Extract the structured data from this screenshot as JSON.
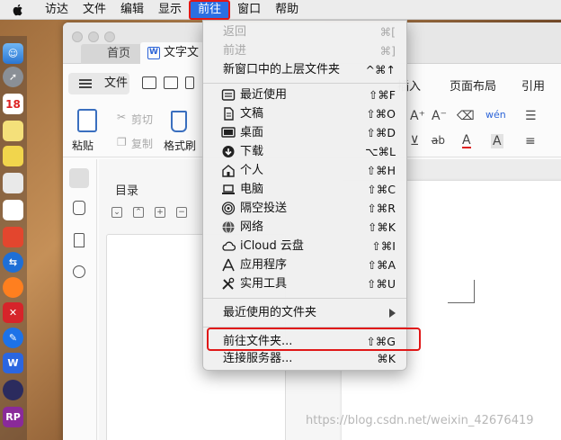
{
  "menubar": {
    "items": [
      "访达",
      "文件",
      "编辑",
      "显示",
      "前往",
      "窗口",
      "帮助"
    ],
    "active_index": 4
  },
  "window": {
    "tabs": [
      "首页",
      "文字文"
    ],
    "file_button": "文件",
    "ribbon_tabs": [
      "插入",
      "页面布局",
      "引用"
    ],
    "ribbon_labels": {
      "paste": "粘贴",
      "cut": "剪切",
      "copy": "复制",
      "format_painter": "格式刷"
    },
    "toc": {
      "title": "目录"
    }
  },
  "go_menu": {
    "items": [
      {
        "label": "返回",
        "shortcut": "⌘[",
        "disabled": true,
        "icon": ""
      },
      {
        "label": "前进",
        "shortcut": "⌘]",
        "disabled": true,
        "icon": ""
      },
      {
        "label": "新窗口中的上层文件夹",
        "shortcut": "^⌘↑",
        "disabled": false,
        "icon": ""
      },
      {
        "label": "最近使用",
        "shortcut": "⇧⌘F",
        "disabled": false,
        "icon": "recents-icon"
      },
      {
        "label": "文稿",
        "shortcut": "⇧⌘O",
        "disabled": false,
        "icon": "documents-icon"
      },
      {
        "label": "桌面",
        "shortcut": "⇧⌘D",
        "disabled": false,
        "icon": "desktop-icon"
      },
      {
        "label": "下载",
        "shortcut": "⌥⌘L",
        "disabled": false,
        "icon": "downloads-icon"
      },
      {
        "label": "个人",
        "shortcut": "⇧⌘H",
        "disabled": false,
        "icon": "home-icon"
      },
      {
        "label": "电脑",
        "shortcut": "⇧⌘C",
        "disabled": false,
        "icon": "computer-icon"
      },
      {
        "label": "隔空投送",
        "shortcut": "⇧⌘R",
        "disabled": false,
        "icon": "airdrop-icon"
      },
      {
        "label": "网络",
        "shortcut": "⇧⌘K",
        "disabled": false,
        "icon": "network-icon"
      },
      {
        "label": "iCloud 云盘",
        "shortcut": "⇧⌘I",
        "disabled": false,
        "icon": "icloud-icon"
      },
      {
        "label": "应用程序",
        "shortcut": "⇧⌘A",
        "disabled": false,
        "icon": "applications-icon"
      },
      {
        "label": "实用工具",
        "shortcut": "⇧⌘U",
        "disabled": false,
        "icon": "utilities-icon"
      },
      {
        "label": "最近使用的文件夹",
        "shortcut": "",
        "disabled": false,
        "icon": ""
      },
      {
        "label": "前往文件夹...",
        "shortcut": "⇧⌘G",
        "disabled": false,
        "icon": ""
      },
      {
        "label": "连接服务器...",
        "shortcut": "⌘K",
        "disabled": false,
        "icon": ""
      }
    ]
  },
  "colors": {
    "menu_highlight": "#2b6fe3",
    "annotation_red": "#e01818"
  },
  "watermark": "https://blog.csdn.net/weixin_42676419"
}
